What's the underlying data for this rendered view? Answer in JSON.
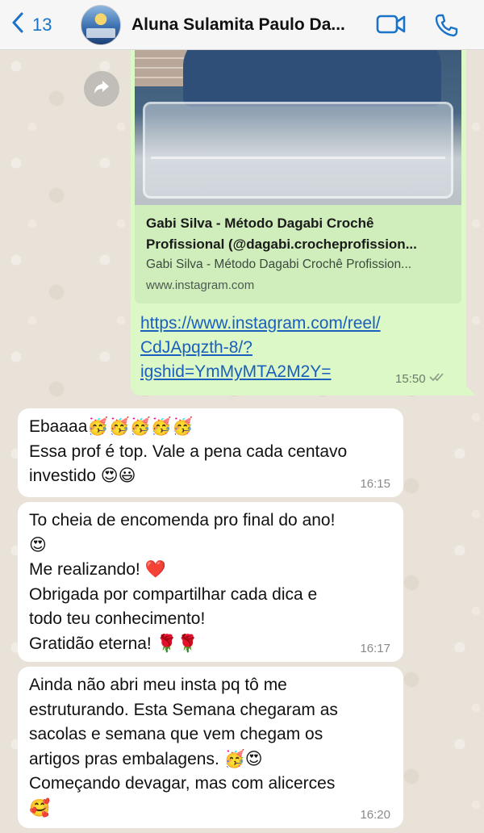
{
  "header": {
    "back_count": "13",
    "contact_name": "Aluna Sulamita Paulo Da..."
  },
  "link_message": {
    "preview_title_line1": "Gabi Silva - Método Dagabi Crochê",
    "preview_title_line2": "Profissional (@dagabi.crocheprofission...",
    "preview_description": "Gabi Silva - Método Dagabi Crochê Profission...",
    "preview_domain": "www.instagram.com",
    "url_lines": [
      "https://www.instagram.com/reel/",
      "CdJApqzth-8/?",
      "igshid=YmMyMTA2M2Y="
    ],
    "time": "15:50"
  },
  "messages": [
    {
      "lines": [
        "Ebaaaa🥳🥳🥳🥳🥳",
        "Essa prof é top. Vale a pena cada centavo",
        "investido 😍😃"
      ],
      "time": "16:15"
    },
    {
      "lines": [
        "To cheia de encomenda pro final do ano!",
        "😍",
        "Me realizando! ❤️",
        "Obrigada por compartilhar cada dica e",
        "todo teu conhecimento!",
        "Gratidão eterna! 🌹🌹"
      ],
      "time": "16:17"
    },
    {
      "lines": [
        "Ainda não abri meu insta pq tô me",
        "estruturando. Esta Semana chegaram as",
        "sacolas e semana que vem chegam os",
        "artigos pras embalagens.  🥳😍",
        "Começando devagar, mas com alicerces",
        "🥰"
      ],
      "time": "16:20"
    }
  ],
  "icons": {
    "back": "chevron-left-icon",
    "video": "video-camera-icon",
    "call": "phone-icon",
    "forward": "forward-arrow-icon",
    "read_receipt": "double-check-icon"
  },
  "colors": {
    "accent": "#1a73c8",
    "outgoing_bubble": "#dcf8c6",
    "incoming_bubble": "#ffffff",
    "link": "#1a5fbd"
  }
}
